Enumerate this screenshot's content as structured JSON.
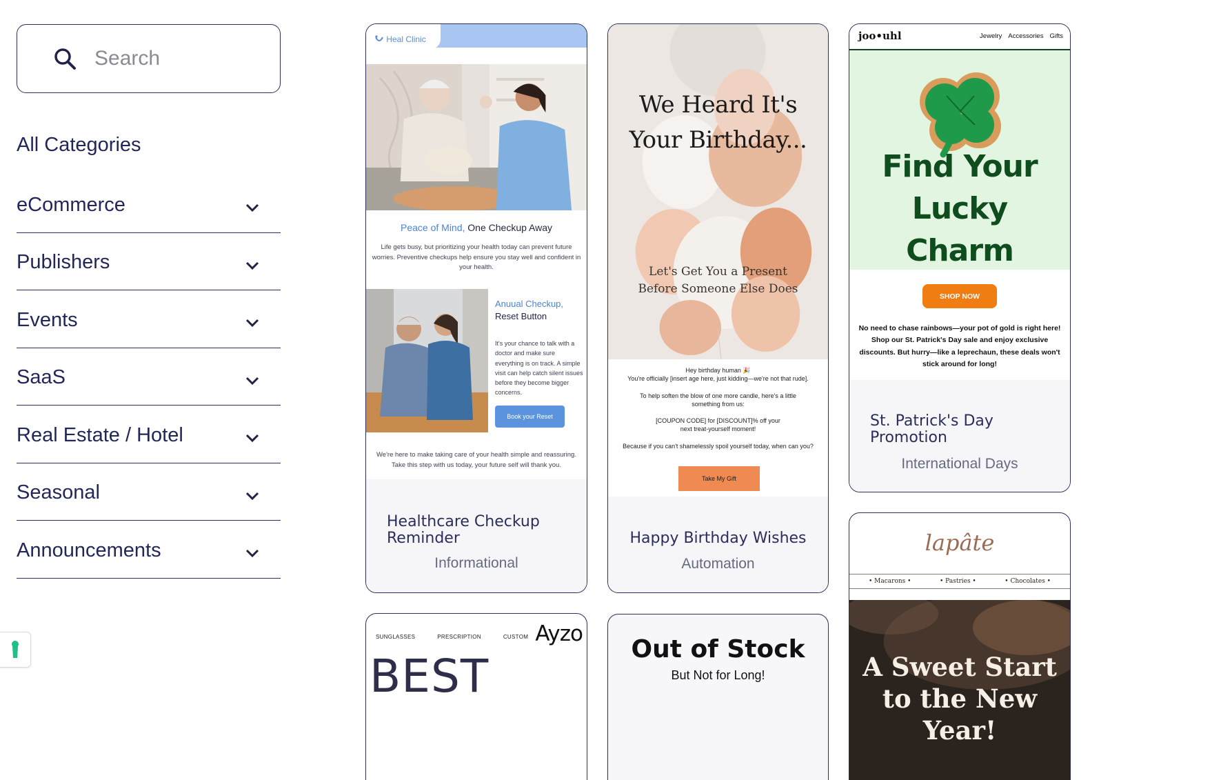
{
  "search": {
    "placeholder": "Search"
  },
  "sidebar": {
    "heading": "All Categories",
    "items": [
      {
        "label": "eCommerce"
      },
      {
        "label": "Publishers"
      },
      {
        "label": "Events"
      },
      {
        "label": "SaaS"
      },
      {
        "label": "Real Estate / Hotel"
      },
      {
        "label": "Seasonal"
      },
      {
        "label": "Announcements"
      }
    ]
  },
  "cards": {
    "healthcare": {
      "title": "Healthcare Checkup Reminder",
      "category": "Informational",
      "logo": "Heal Clinic",
      "headline_blue": "Peace of Mind,",
      "headline_dark": " One Checkup Away",
      "body": "Life gets busy, but prioritizing your health today can prevent future worries. Preventive checkups help ensure you stay well and confident in your health.",
      "side_title_blue": "Anuual Checkup,",
      "side_title_dark": " Reset Button",
      "side_body": "It's your chance to talk with a doctor and make sure everything is on track. A simple visit can help catch silent issues before they become bigger concerns.",
      "button": "Book your Reset",
      "bottom": "We're here to make taking care of your health simple and reassuring. Take this step with us today, your future self will thank you."
    },
    "birthday": {
      "title": "Happy Birthday Wishes",
      "category": "Automation",
      "headline": "We Heard It's Your Birthday...",
      "subheadline": "Let's Get You a Present Before Someone Else Does",
      "greeting": "Hey birthday human 🎉",
      "line1": "You're officially [insert age here, just kidding—we're not that rude].",
      "line2": "To help soften the blow of one more candle, here's a little something from us:",
      "line3": "[COUPON CODE] for [DISCOUNT]% off your next treat-yourself moment!",
      "line4": "Because if you can't shamelessly spoil yourself today, when can you?",
      "button": "Take My Gift"
    },
    "stpatricks": {
      "title": "St. Patrick's Day Promotion",
      "category": "International Days",
      "logo": "joo•uhl",
      "nav": [
        "Jewelry",
        "Accessories",
        "Gifts"
      ],
      "headline": "Find Your Lucky Charm",
      "button": "SHOP NOW",
      "body": "No need to chase rainbows—your pot of gold is right here! Shop our St. Patrick's Day sale and enjoy exclusive discounts. But hurry—like a leprechaun, these deals won't stick around for long!"
    },
    "bakery": {
      "logo": "lapâte",
      "nav": [
        "• Macarons •",
        "• Pastries •",
        "• Chocolates •"
      ],
      "headline": "A Sweet Start to the New Year!"
    },
    "ayzo": {
      "nav": [
        "SUNGLASSES",
        "PRESCRIPTION",
        "CUSTOM"
      ],
      "logo": "Ayzo",
      "headline": "BEST"
    },
    "stock": {
      "headline": "Out of Stock",
      "subheadline": "But Not for Long!"
    }
  },
  "colors": {
    "brand_navy": "#2a2e5c",
    "healthcare_blue": "#5b93de",
    "birthday_orange": "#ef8a52",
    "lucky_green": "#0f4d1e",
    "shop_orange": "#f07d12"
  }
}
